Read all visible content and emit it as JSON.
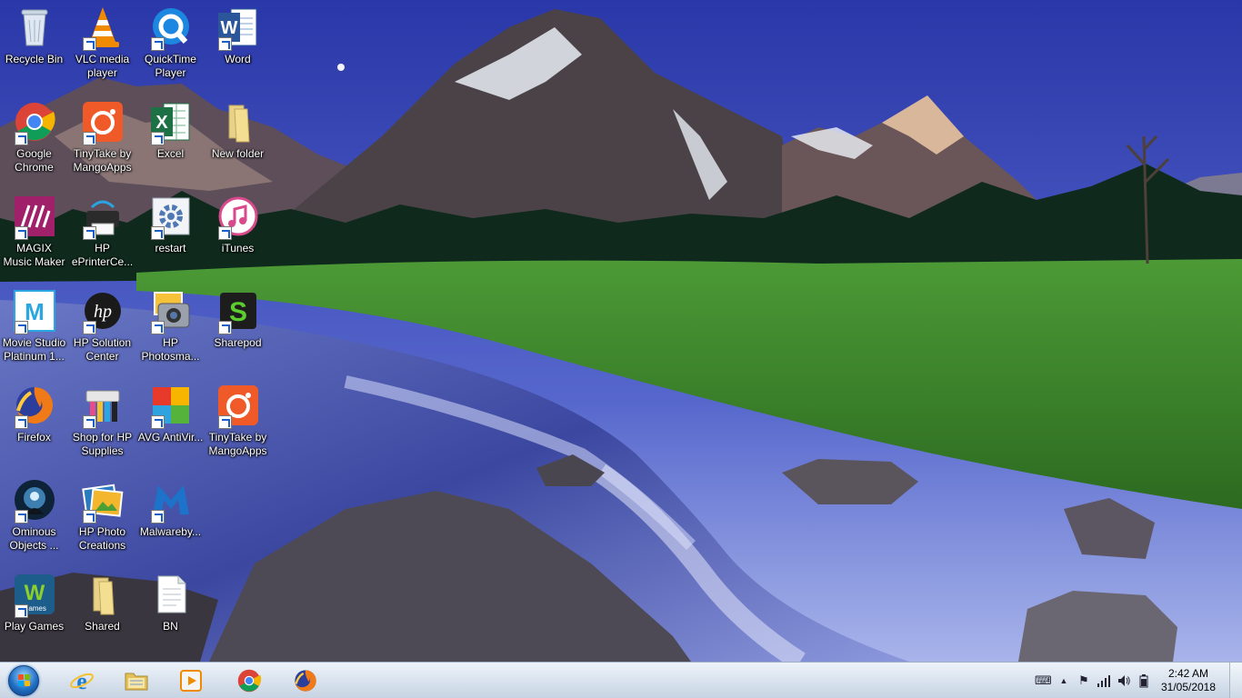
{
  "desktop": {
    "icons": [
      {
        "label": "Recycle Bin",
        "icon": "recycle-bin-icon",
        "shortcut": false
      },
      {
        "label": "VLC media player",
        "icon": "vlc-cone-icon",
        "shortcut": true
      },
      {
        "label": "QuickTime Player",
        "icon": "quicktime-icon",
        "shortcut": true
      },
      {
        "label": "Word",
        "icon": "word-icon",
        "shortcut": true
      },
      {
        "label": "Google Chrome",
        "icon": "chrome-icon",
        "shortcut": true
      },
      {
        "label": "TinyTake by MangoApps",
        "icon": "tinytake-icon",
        "shortcut": true
      },
      {
        "label": "Excel",
        "icon": "excel-icon",
        "shortcut": true
      },
      {
        "label": "New folder",
        "icon": "folder-icon",
        "shortcut": false
      },
      {
        "label": "MAGIX Music Maker",
        "icon": "magix-icon",
        "shortcut": true
      },
      {
        "label": "HP ePrinterCe...",
        "icon": "printer-icon",
        "shortcut": true
      },
      {
        "label": "restart",
        "icon": "settings-gear-icon",
        "shortcut": true
      },
      {
        "label": "iTunes",
        "icon": "itunes-icon",
        "shortcut": true
      },
      {
        "label": "Movie Studio Platinum 1...",
        "icon": "movie-studio-icon",
        "shortcut": true
      },
      {
        "label": "HP Solution Center",
        "icon": "hp-logo-icon",
        "shortcut": true
      },
      {
        "label": "HP Photosma...",
        "icon": "photosmart-icon",
        "shortcut": true
      },
      {
        "label": "Sharepod",
        "icon": "sharepod-icon",
        "shortcut": true
      },
      {
        "label": "Firefox",
        "icon": "firefox-icon",
        "shortcut": true
      },
      {
        "label": "Shop for HP Supplies",
        "icon": "hp-supplies-icon",
        "shortcut": true
      },
      {
        "label": "AVG AntiVir...",
        "icon": "avg-icon",
        "shortcut": true
      },
      {
        "label": "TinyTake by MangoApps",
        "icon": "tinytake-icon",
        "shortcut": true
      },
      {
        "label": "Ominous Objects ...",
        "icon": "game-icon",
        "shortcut": true
      },
      {
        "label": "HP Photo Creations",
        "icon": "hp-photo-creations-icon",
        "shortcut": true
      },
      {
        "label": "Malwareby...",
        "icon": "malwarebytes-icon",
        "shortcut": true
      },
      {
        "label": "Play Games",
        "icon": "wild-games-icon",
        "shortcut": true
      },
      {
        "label": "Shared",
        "icon": "folder-icon",
        "shortcut": false
      },
      {
        "label": "BN",
        "icon": "text-file-icon",
        "shortcut": false
      }
    ]
  },
  "taskbar": {
    "pinned": [
      {
        "name": "internet-explorer",
        "icon": "internet-explorer-icon"
      },
      {
        "name": "file-explorer",
        "icon": "file-explorer-icon"
      },
      {
        "name": "media-player",
        "icon": "media-player-icon"
      },
      {
        "name": "chrome",
        "icon": "chrome-icon"
      },
      {
        "name": "firefox",
        "icon": "firefox-icon"
      }
    ],
    "tray": [
      "keyboard-icon",
      "show-hidden-icons-icon",
      "action-center-flag-icon",
      "network-signal-icon",
      "volume-icon",
      "battery-icon"
    ],
    "clock": {
      "time": "2:42 AM",
      "date": "31/05/2018"
    }
  },
  "colors": {
    "sky_top": "#2f3fb3",
    "sky_bottom": "#8fa4e8",
    "meadow": "#3f8f2c",
    "water": "#3d4ca6",
    "taskbar": "#d6e0ec"
  }
}
